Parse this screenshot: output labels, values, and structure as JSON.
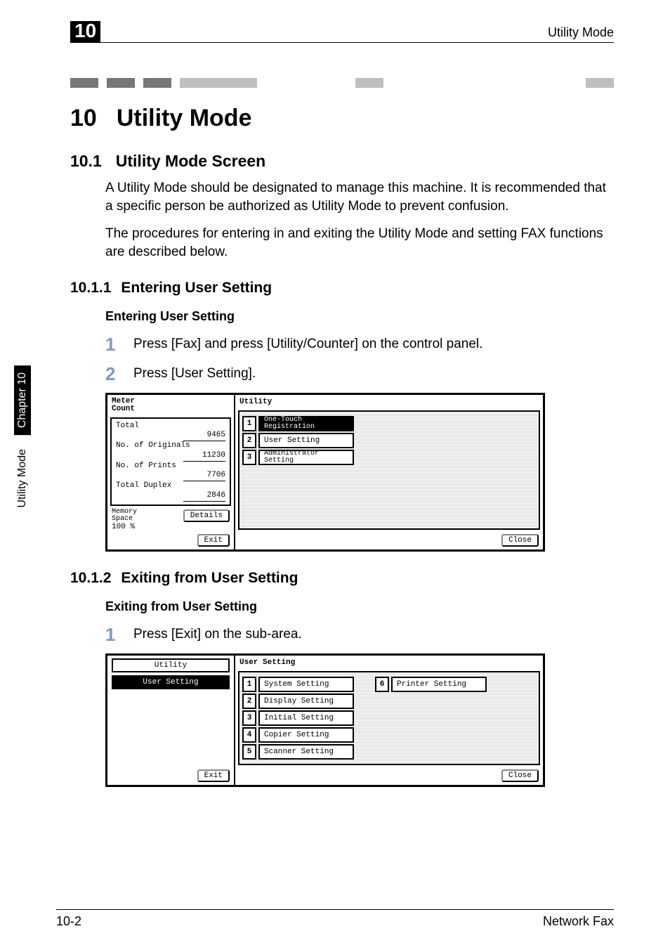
{
  "header": {
    "chapter_number": "10",
    "title_right": "Utility Mode"
  },
  "h1": {
    "num": "10",
    "text": "Utility Mode"
  },
  "sec1": {
    "num": "10.1",
    "text": "Utility Mode Screen"
  },
  "p1": "A Utility Mode should be designated to manage this machine. It is recommended that a specific person be authorized as Utility Mode to prevent confusion.",
  "p2": "The procedures for entering in and exiting the Utility Mode and setting FAX functions are described below.",
  "sub1": {
    "num": "10.1.1",
    "text": "Entering User Setting"
  },
  "sub1_h4": "Entering User Setting",
  "step1": {
    "n": "1",
    "t": "Press [Fax] and press [Utility/Counter] on the control panel."
  },
  "step2": {
    "n": "2",
    "t": "Press [User Setting]."
  },
  "sub2": {
    "num": "10.1.2",
    "text": "Exiting from User Setting"
  },
  "sub2_h4": "Exiting from User Setting",
  "step3": {
    "n": "1",
    "t": "Press [Exit] on the sub-area."
  },
  "sidetab": {
    "chapter": "Chapter 10",
    "label": "Utility Mode"
  },
  "footer": {
    "left": "10-2",
    "right": "Network Fax"
  },
  "panel1": {
    "left": {
      "header": "Meter\nCount",
      "total_label": "Total",
      "total_val": "9465",
      "orig_label": "No. of Originals",
      "orig_val": "11230",
      "prints_label": "No. of Prints",
      "prints_val": "7706",
      "duplex_label": "Total Duplex",
      "duplex_val": "2846",
      "mem_label": "Memory\nSpace",
      "mem_val": "100 %",
      "details": "Details",
      "exit": "Exit"
    },
    "right": {
      "header": "Utility",
      "items": [
        {
          "n": "1",
          "label": "One-Touch\nRegistration"
        },
        {
          "n": "2",
          "label": "User Setting"
        },
        {
          "n": "3",
          "label": "Administrator\nSetting"
        }
      ],
      "close": "Close"
    }
  },
  "panel2": {
    "left": {
      "utility": "Utility",
      "user_setting": "User Setting",
      "exit": "Exit"
    },
    "right": {
      "header": "User Setting",
      "items": [
        {
          "n": "1",
          "label": "System Setting"
        },
        {
          "n": "2",
          "label": "Display Setting"
        },
        {
          "n": "3",
          "label": "Initial Setting"
        },
        {
          "n": "4",
          "label": "Copier Setting"
        },
        {
          "n": "5",
          "label": "Scanner Setting"
        }
      ],
      "items_r": [
        {
          "n": "6",
          "label": "Printer Setting"
        }
      ],
      "close": "Close"
    }
  }
}
